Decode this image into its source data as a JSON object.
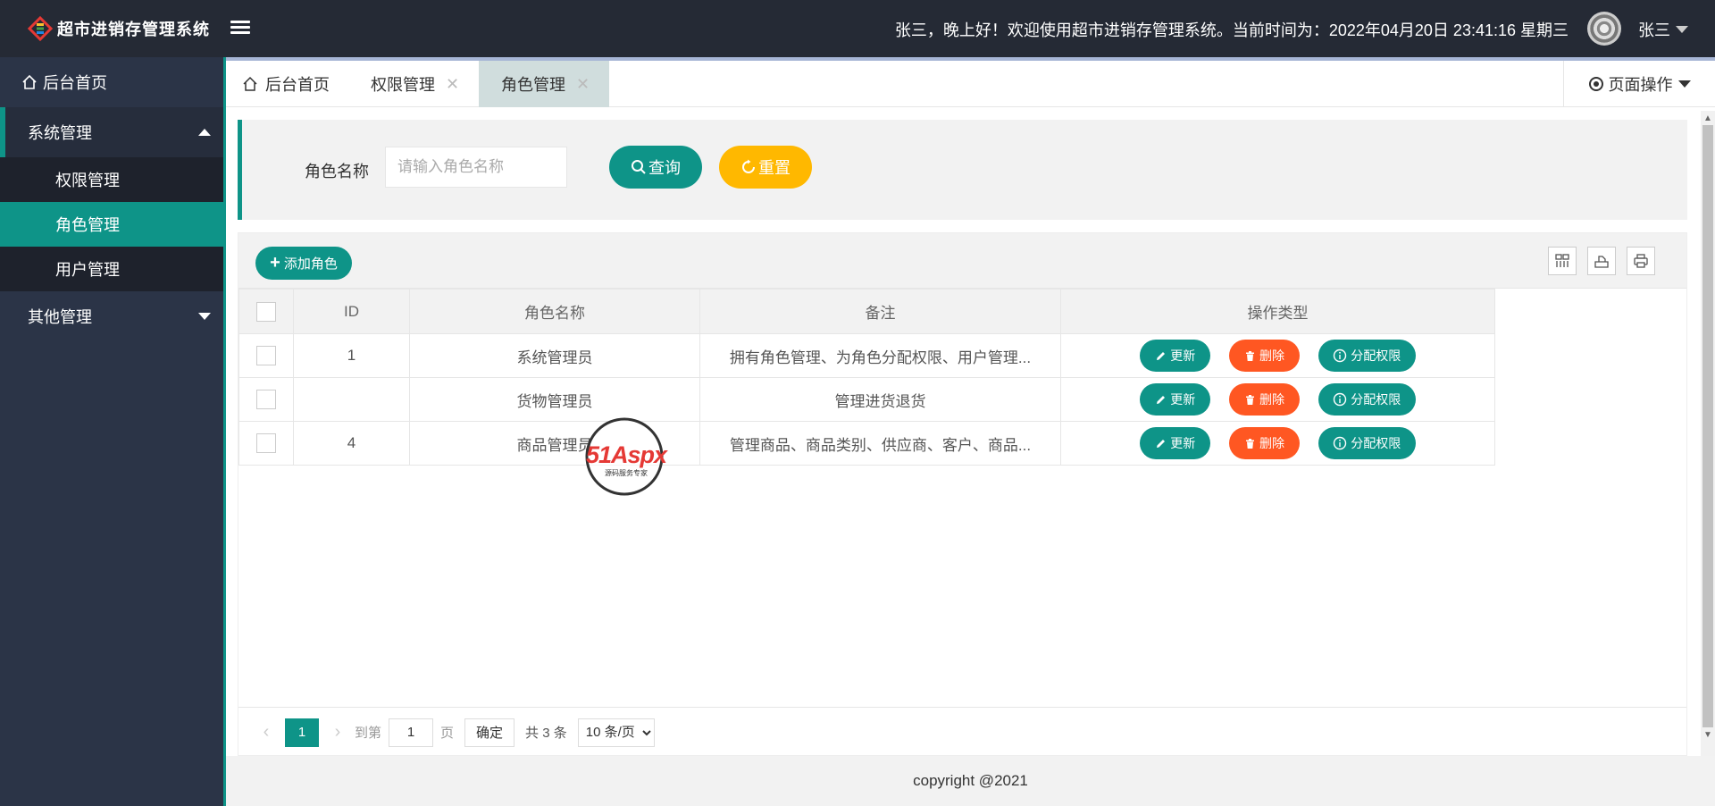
{
  "app": {
    "logo_text": "超市进销存管理系统",
    "brand_color": "#0e9488"
  },
  "header": {
    "greeting": "张三，晚上好！欢迎使用超市进销存管理系统。当前时间为：2022年04月20日 23:41:16 星期三",
    "user_name": "张三"
  },
  "sidebar": {
    "home": "后台首页",
    "groups": [
      {
        "label": "系统管理",
        "open": true,
        "items": [
          "权限管理",
          "角色管理",
          "用户管理"
        ],
        "active": "角色管理"
      },
      {
        "label": "其他管理",
        "open": false
      }
    ]
  },
  "tabs": [
    {
      "label": "后台首页"
    },
    {
      "label": "权限管理"
    },
    {
      "label": "角色管理"
    }
  ],
  "tab_ops": "页面操作",
  "search": {
    "label": "角色名称",
    "placeholder": "请输入角色名称",
    "query_btn": "查询",
    "reset_btn": "重置"
  },
  "toolbar": {
    "add_btn": "添加角色"
  },
  "table": {
    "columns": [
      "ID",
      "角色名称",
      "备注",
      "操作类型"
    ],
    "rows": [
      {
        "id": "1",
        "name": "系统管理员",
        "remark": "拥有角色管理、为角色分配权限、用户管理..."
      },
      {
        "id": "",
        "name": "货物管理员",
        "remark": "管理进货退货"
      },
      {
        "id": "4",
        "name": "商品管理员",
        "remark": "管理商品、商品类别、供应商、客户、商品..."
      }
    ],
    "ops": {
      "update": "更新",
      "delete": "删除",
      "assign": "分配权限"
    }
  },
  "pager": {
    "current": "1",
    "goto_prefix": "到第",
    "goto_value": "1",
    "goto_suffix": "页",
    "confirm": "确定",
    "total": "共 3 条",
    "page_size": "10 条/页"
  },
  "watermark": {
    "text": "51Aspx",
    "subtext": "源码服务专家"
  },
  "footer": "copyright @2021"
}
